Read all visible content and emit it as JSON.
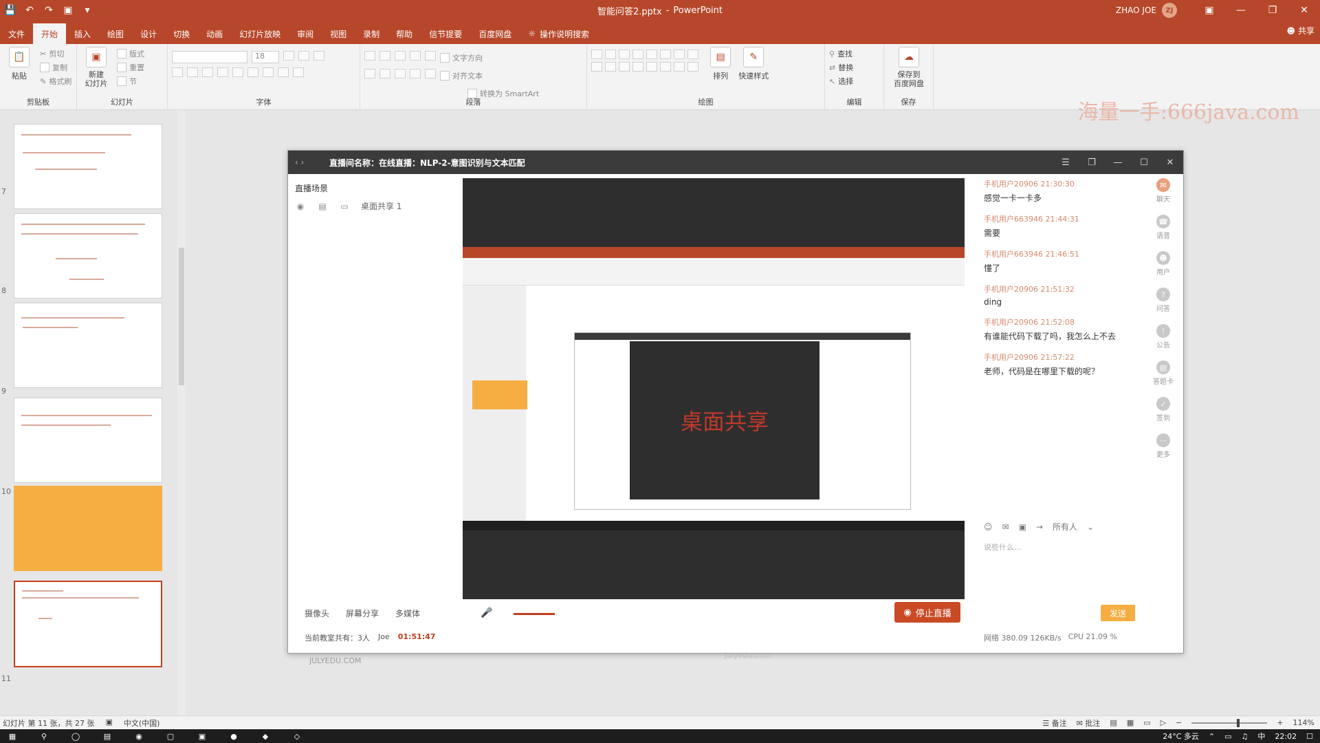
{
  "window": {
    "filename": "智能问答2.pptx",
    "separator": "-",
    "app": "PowerPoint",
    "user_name": "ZHAO JOE",
    "user_initials": "ZJ"
  },
  "tabs": [
    "文件",
    "开始",
    "插入",
    "绘图",
    "设计",
    "切换",
    "动画",
    "幻灯片放映",
    "审阅",
    "视图",
    "录制",
    "帮助",
    "信节提要",
    "百度网盘"
  ],
  "search_label": "操作说明搜索",
  "share_label": "共享",
  "ribbon": {
    "paste": "粘贴",
    "cut": "剪切",
    "copy": "复制",
    "format_painter": "格式刷",
    "clipboard": "剪贴板",
    "new_slide": "新建\n幻灯片",
    "layout": "版式",
    "reset": "重置",
    "section": "节",
    "slides": "幻灯片",
    "font_size": "18",
    "font": "字体",
    "paragraph": "段落",
    "text_direction": "文字方向",
    "align_text": "对齐文本",
    "smartart": "转换为 SmartArt",
    "arrange": "排列",
    "quick_styles": "快速样式",
    "drawing": "绘图",
    "find": "查找",
    "replace": "替换",
    "select": "选择",
    "editing": "编辑",
    "save_to": "保存到\n百度网盘",
    "save": "保存"
  },
  "watermark": "海量一手:666java.com",
  "thumbs": {
    "numbers": [
      "7",
      "8",
      "9",
      "10",
      "11"
    ]
  },
  "live": {
    "title": "直播间名称：在线直播：NLP-2-意图识别与文本匹配",
    "scene_label": "直播场景",
    "scene_item": "桌面共享 1",
    "desktop_share": "桌面共享",
    "controls": [
      "摄像头",
      "屏幕分享",
      "多媒体"
    ],
    "stop": "停止直播",
    "viewers": "当前教室共有：3人",
    "user": "Joe",
    "time": "01:51:47",
    "messages": [
      {
        "who": "手机用户20906 21:30:30",
        "text": "感觉一卡一卡多"
      },
      {
        "who": "手机用户663946 21:44:31",
        "text": "需要"
      },
      {
        "who": "手机用户663946 21:46:51",
        "text": "懂了"
      },
      {
        "who": "手机用户20906 21:51:32",
        "text": "ding"
      },
      {
        "who": "手机用户20906 21:52:08",
        "text": "有谁能代码下载了吗，我怎么上不去"
      },
      {
        "who": "手机用户20906 21:57:22",
        "text": "老师，代码是在哪里下载的呢？"
      }
    ],
    "recipient": "所有人",
    "input_placeholder": "说些什么...",
    "send": "发送",
    "net_status": "网络 380.09 126KB/s",
    "cpu": "CPU 21.09 %",
    "side": [
      "聊天",
      "语音",
      "用户",
      "问答",
      "公告",
      "答题卡",
      "签到",
      "更多"
    ]
  },
  "slide_footer": "JULYEDU.COM",
  "slide_footer2": "julyedu.com",
  "status": {
    "slide_info": "幻灯片 第 11 张，共 27 张",
    "language": "中文(中国)",
    "notes": "备注",
    "comments": "批注",
    "zoom": "114%"
  },
  "taskbar": {
    "weather": "24°C 多云",
    "time": "22:02",
    "ime": "中"
  },
  "colors": {
    "accent": "#b7472a",
    "orange": "#f6ae42",
    "stop": "#c94a24"
  }
}
